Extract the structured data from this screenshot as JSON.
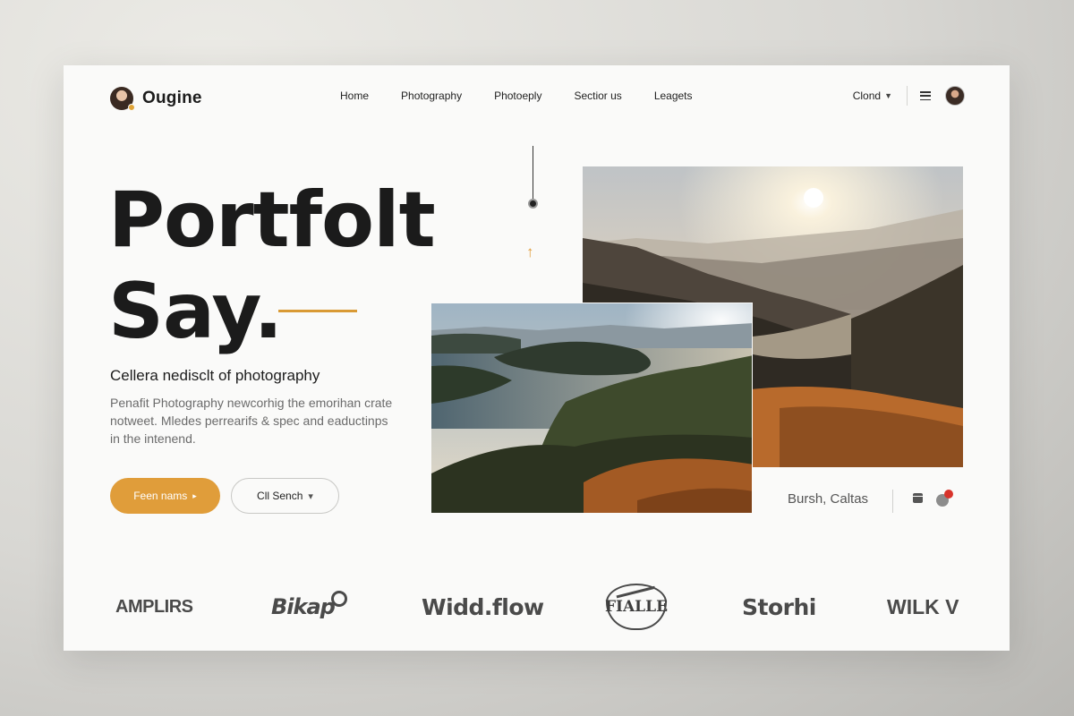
{
  "header": {
    "brand": "Ougine",
    "nav": [
      "Home",
      "Photography",
      "Photoeply",
      "Sectior us",
      "Leagets"
    ],
    "account_label": "Clond",
    "icons": {
      "menu": "menu-icon",
      "avatar": "user-avatar"
    }
  },
  "hero": {
    "title_line1": "Portfolt",
    "title_line2": "Say.",
    "subtitle": "Cellera nedisclt of photography",
    "description": "Penafit Photography newcorhig the emorihan crate notweet. Mledes perrearifs & spec and eaductinps in the intenend.",
    "primary_button": "Feen nams",
    "primary_button_icon": "▸",
    "secondary_button": "Cll Sench",
    "secondary_button_icon": "▾"
  },
  "gallery": {
    "caption": "Bursh, Caltas",
    "notification_count": ""
  },
  "logos": [
    "AMPLIRS",
    "Bikap",
    "Widd.flow",
    "FIALLE",
    "Storhi",
    "WILK V"
  ],
  "colors": {
    "accent": "#e09d3a",
    "text": "#1b1b1b",
    "muted": "#6b6b6b",
    "badge": "#d8332b"
  }
}
